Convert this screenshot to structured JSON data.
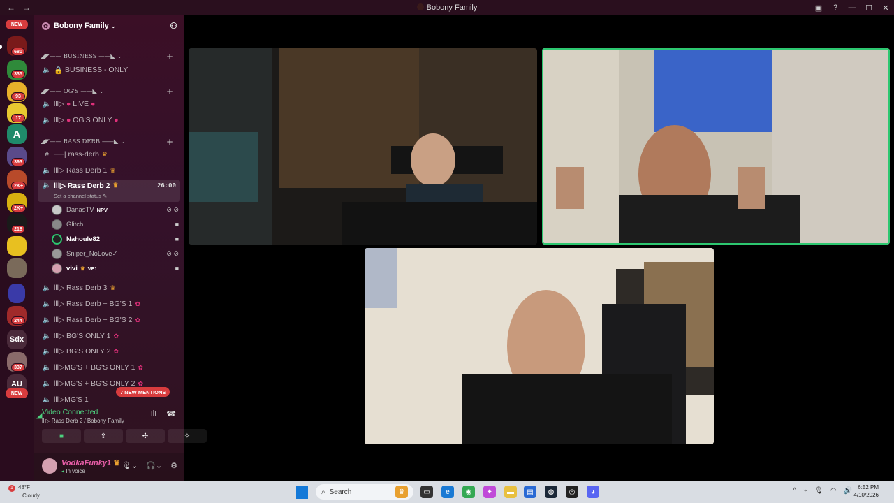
{
  "window": {
    "title": "Bobony Family"
  },
  "rail": {
    "new_top": "NEW",
    "badges": [
      "680",
      "335",
      "93",
      "17",
      "393",
      "2K+",
      "2K+",
      "218",
      "137",
      "244",
      "337"
    ],
    "text_servers": [
      "Sdx",
      "AU"
    ],
    "new_bottom": "NEW"
  },
  "server": {
    "name": "Bobony Family"
  },
  "categories": [
    {
      "label": "◢◤—— BUSINESS ——◣ ⌄"
    },
    {
      "label": "◢◤—— OG'S ——◣ ⌄"
    },
    {
      "label": "◢◤—— RASS DERB ——◣ ⌄"
    }
  ],
  "channels": [
    {
      "prefix": "🔒",
      "label": "BUSINESS - ONLY"
    },
    {
      "prefix": "lll▷",
      "label": "LIVE"
    },
    {
      "prefix": "lll▷",
      "label": "OG'S ONLY"
    },
    {
      "prefix": "",
      "label": "──| rass-derb"
    },
    {
      "prefix": "",
      "label": "lll▷ Rass Derb 1"
    },
    {
      "prefix": "",
      "label": "lll▷ Rass Derb 2",
      "timer": "26:00",
      "status": "Set a channel status ✎"
    },
    {
      "prefix": "",
      "label": "lll▷ Rass Derb 3"
    },
    {
      "prefix": "",
      "label": "lll▷ Rass Derb + BG'S 1"
    },
    {
      "prefix": "",
      "label": "lll▷ Rass Derb + BG'S 2"
    },
    {
      "prefix": "",
      "label": "lll▷ BG'S ONLY 1"
    },
    {
      "prefix": "",
      "label": "lll▷ BG'S ONLY 2"
    },
    {
      "prefix": "",
      "label": "lll▷MG'S + BG'S ONLY 1"
    },
    {
      "prefix": "",
      "label": "lll▷MG'S + BG'S ONLY 2"
    },
    {
      "prefix": "",
      "label": "lll▷MG'S 1"
    }
  ],
  "voice_users": [
    {
      "name": "DanasTV",
      "tag": "NPV"
    },
    {
      "name": "Glitch",
      "tag": ""
    },
    {
      "name": "Nahoule82",
      "tag": ""
    },
    {
      "name": "Sniper_NoLove✓",
      "tag": ""
    },
    {
      "name": "vivi",
      "tag": "VF1"
    }
  ],
  "mentions": "7 NEW MENTIONS",
  "voice_panel": {
    "status": "Video Connected",
    "channel": "lll▷ Rass Derb 2 / Bobony Family"
  },
  "user_panel": {
    "name": "VodkaFunky1",
    "status": "In voice"
  },
  "taskbar": {
    "weather_temp": "48°F",
    "weather_desc": "Cloudy",
    "search": "Search",
    "time": "6:52 PM",
    "date": "4/10/2026"
  },
  "colors": {
    "speaking": "#2dc770",
    "sidebar": "#3b0f26",
    "badge": "#d83c3e"
  }
}
